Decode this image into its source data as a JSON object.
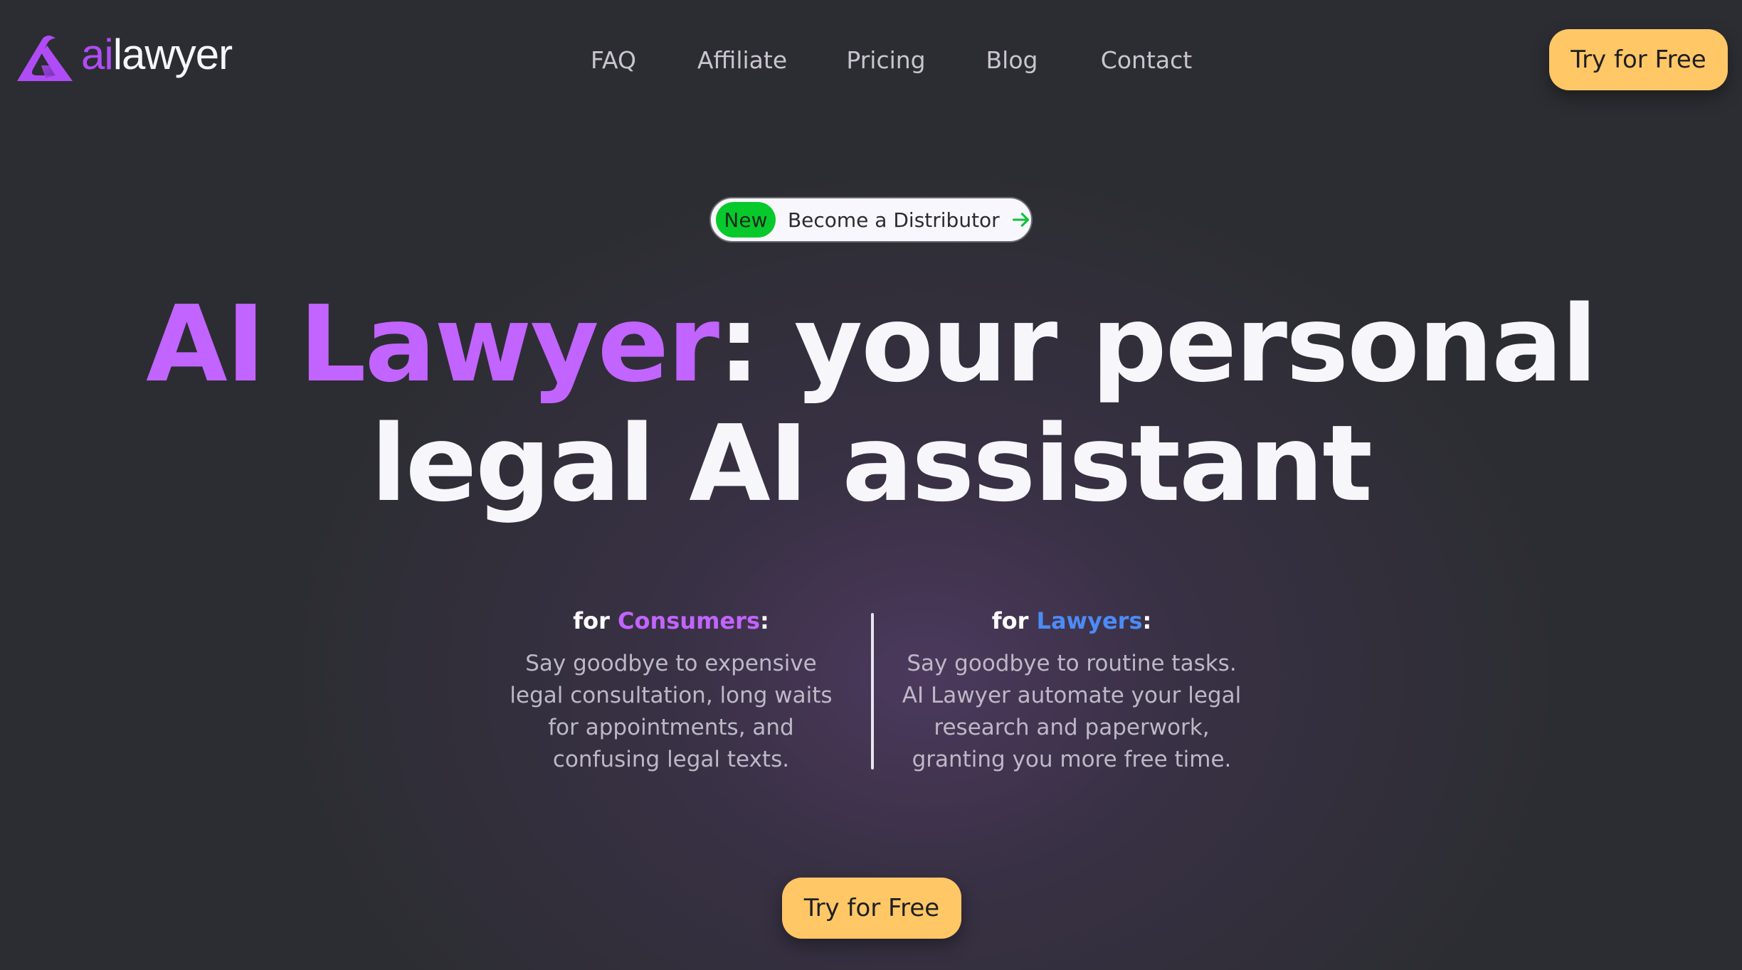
{
  "brand": {
    "logo_ai": "ai",
    "logo_rest": "lawyer",
    "logo_icon": "ailawyer-logo-icon"
  },
  "nav": {
    "items": [
      {
        "label": "FAQ"
      },
      {
        "label": "Affiliate"
      },
      {
        "label": "Pricing"
      },
      {
        "label": "Blog"
      },
      {
        "label": "Contact"
      }
    ],
    "cta_label": "Try for Free"
  },
  "badge": {
    "tag": "New",
    "text": "Become a Distributor",
    "icon": "arrow-right-icon"
  },
  "hero": {
    "title_accent": "AI Lawyer",
    "title_rest_line1": ": your personal",
    "title_line2": "legal AI assistant"
  },
  "audiences": [
    {
      "prefix": "for ",
      "name": "Consumers",
      "suffix": ":",
      "lines": [
        "Say goodbye to expensive",
        "legal consultation, long waits",
        "for appointments, and",
        "confusing legal texts."
      ]
    },
    {
      "prefix": "for ",
      "name": "Lawyers",
      "suffix": ":",
      "lines": [
        "Say goodbye to routine tasks.",
        "AI Lawyer automate your legal",
        "research and paperwork,",
        "granting you more free time."
      ]
    }
  ],
  "cta": {
    "label": "Try for Free"
  },
  "colors": {
    "background": "#2c2d32",
    "accent_purple": "#c264ff",
    "accent_blue": "#4c8bf5",
    "cta_yellow": "#ffc766",
    "badge_green": "#08c92c"
  }
}
